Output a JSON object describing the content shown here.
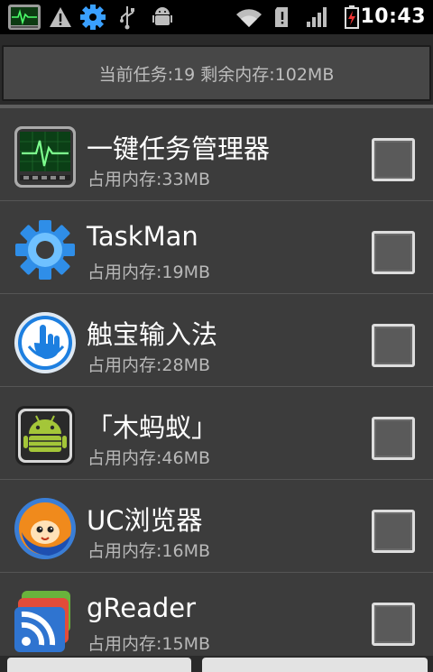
{
  "status_bar": {
    "time": "10:43",
    "icons": [
      "taskmanager-app-icon",
      "warning-icon",
      "settings-gear-icon",
      "usb-icon",
      "android-debug-icon",
      "wifi-icon",
      "sd-card-icon",
      "signal-bars-icon",
      "battery-charging-icon"
    ]
  },
  "summary": {
    "text": "当前任务:19 剩余内存:102MB"
  },
  "apps": [
    {
      "name": "一键任务管理器",
      "memory": "占用内存:33MB",
      "icon": "heart-monitor-icon",
      "checked": false
    },
    {
      "name": "TaskMan",
      "memory": "占用内存:19MB",
      "icon": "blue-gear-icon",
      "checked": false
    },
    {
      "name": "触宝输入法",
      "memory": "占用内存:28MB",
      "icon": "touchpal-hand-icon",
      "checked": false
    },
    {
      "name": "「木蚂蚁」",
      "memory": "占用内存:46MB",
      "icon": "android-robot-icon",
      "checked": false
    },
    {
      "name": "UC浏览器",
      "memory": "占用内存:16MB",
      "icon": "uc-squirrel-icon",
      "checked": false
    },
    {
      "name": "gReader",
      "memory": "占用内存:15MB",
      "icon": "rss-reader-icon",
      "checked": false
    }
  ],
  "colors": {
    "background": "#3c3c3c",
    "status_bar": "#000000",
    "summary_text": "#bdbdbd",
    "memory_text": "#b8b8b8"
  }
}
